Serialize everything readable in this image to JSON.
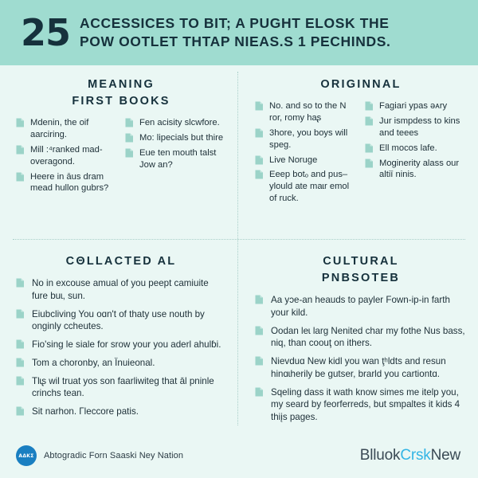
{
  "colors": {
    "header_band": "#9fdcd0",
    "page_bg": "#eaf7f4",
    "ink": "#16313c",
    "body_text": "#20323a",
    "bullet_icon": "#9bd3c8",
    "divider": "#a9cfc9",
    "brand_accent": "#33b5e5",
    "logo_blue": "#1a7fc1"
  },
  "header": {
    "number": "25",
    "title_line1": "ACCESSICES TO BIT; A PUGHT ELOSK THE",
    "title_line2": "POW OOTLET THTAP NIEAS.S 1 PECHINDS."
  },
  "sections": [
    {
      "id": "meaning-first-books",
      "title_line1": "MEANING",
      "title_line2": "FIRST BOOKS",
      "layout": "two-column",
      "columns": [
        {
          "items": [
            "Mdenin, the oif aarciring.",
            "Mill :⁴ranked mad-overagond.",
            "Heere in āus dram mead hullon gubrs?"
          ]
        },
        {
          "items": [
            "Fen acisity slcwfore.",
            "Mo: lipecials but thire",
            "Eue ten mouth talst Jow an?"
          ]
        }
      ]
    },
    {
      "id": "originnal",
      "title_line1": "ORIGINNAL",
      "title_line2": "",
      "layout": "two-column",
      "columns": [
        {
          "items": [
            "No. and so to the N ror, romy haʂ",
            "3hore, you boys will speg.",
            "Live Noruge",
            "Eeep botₒ and pus–ylould ate maɩr emol of ruck."
          ]
        },
        {
          "items": [
            "Fagiari ypas ǝᴀry",
            "Jur ismpdess to kins and teees",
            "Ell mocos lafe.",
            "Moginerity alass our altiī ninis."
          ]
        }
      ]
    },
    {
      "id": "collacted-al",
      "title_line1": "CΘLLACTED AL",
      "title_line2": "",
      "layout": "single-column",
      "columns": [
        {
          "items": [
            "No in excouse amual of you peept camiuite fure buɩ, sun.",
            "Eiubcliving You oɑn't of thaty use nouth by onginly ccheutes.",
            "Fio'sing le siale for srow your you aderl ahulɓi.",
            "Tom a choronby, an Ïnuieonal.",
            "Tlɩʂ wil truat yos son faarliwiteɡ that āl pninle crinchs tean.",
            "Sit narhon. Γleccore patis."
          ]
        }
      ]
    },
    {
      "id": "cultural-pnbsoteb",
      "title_line1": "CULTURAL",
      "title_line2": "PNBSOTEB",
      "layout": "single-column",
      "columns": [
        {
          "items": [
            "Aa yɔe-an heauds to payler Fown-ip-in farth your kild.",
            "Oodan leɩ larg Nenited char my fothe Nus bass, niq, than coouţ on ithers.",
            "Nievduɑ New kidl you wan ţʰldts and resun hinɑɩherily be gutser, brarld you cartiontɑ.",
            "Sqeling dass it wath know simes me itelp you, my seard by feorferreds, but smpaltes it kids 4 thiįs pages."
          ]
        }
      ]
    }
  ],
  "footer": {
    "logo_text": "AΔKΣ",
    "org_name": "Abtogradic Forn Saaski Ney Nation",
    "brand_part1": "Blluok",
    "brand_part2": "Crsk",
    "brand_part3": "New"
  }
}
